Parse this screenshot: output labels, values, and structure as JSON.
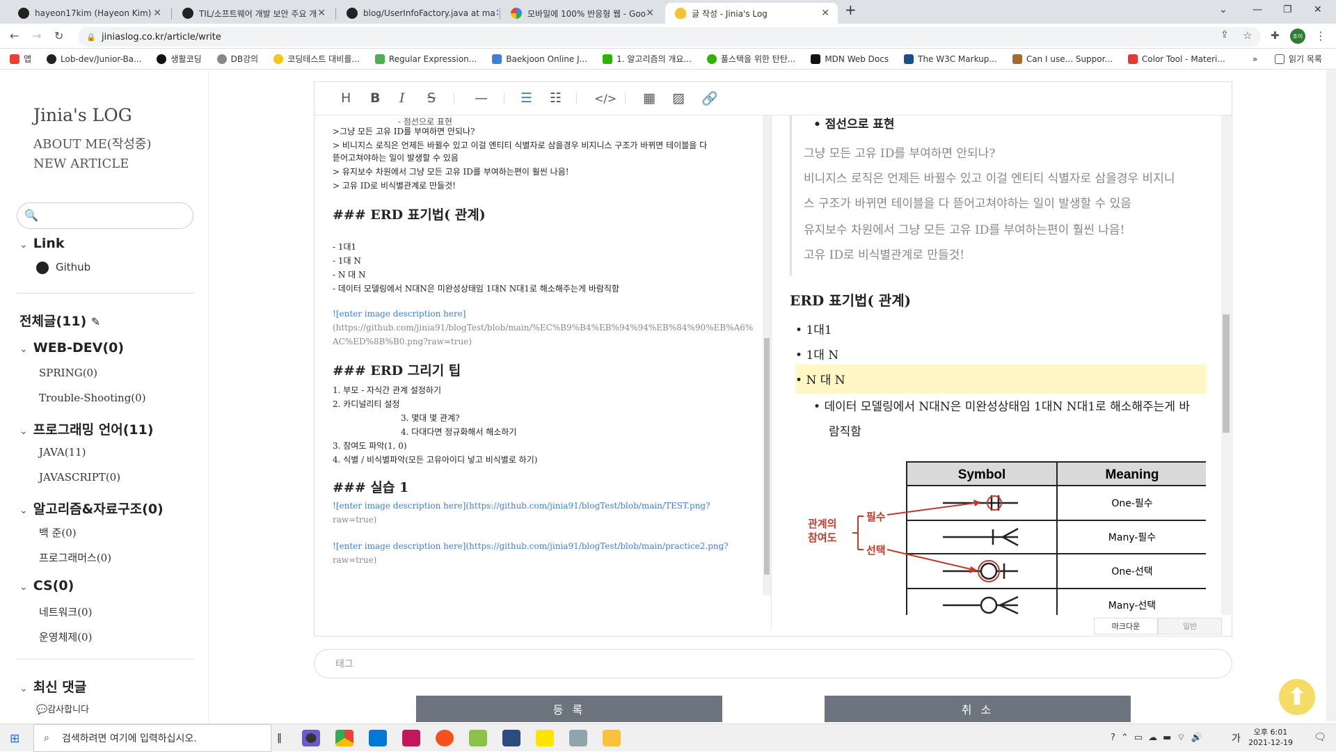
{
  "browser": {
    "tabs": [
      {
        "title": "hayeon17kim (Hayeon Kim)",
        "icon": "github-icon"
      },
      {
        "title": "TIL/소프트웨어 개발 보안 주요 개",
        "icon": "github-icon"
      },
      {
        "title": "blog/UserInfoFactory.java at ma",
        "icon": "github-icon"
      },
      {
        "title": "모바일에 100% 반응형 웹 - Goo",
        "icon": "google-icon"
      },
      {
        "title": "글 작성 - Jinia's Log",
        "icon": "bulb-icon"
      }
    ],
    "new_tab": "+",
    "url": "jiniaslog.co.kr/article/write",
    "profile": "조이",
    "bookmarks": [
      {
        "label": "앱",
        "color": "#e94235"
      },
      {
        "label": "Lob-dev/Junior-Ba...",
        "color": "#222222"
      },
      {
        "label": "생활코딩",
        "color": "#111111"
      },
      {
        "label": "DB강의",
        "color": "#555555"
      },
      {
        "label": "코딩테스트 대비를...",
        "color": "#f5c518"
      },
      {
        "label": "Regular Expression...",
        "color": "#4caf50"
      },
      {
        "label": "Baekjoon Online J...",
        "color": "#3f7fd8"
      },
      {
        "label": "1. 알고리즘의 개요...",
        "color": "#2db400"
      },
      {
        "label": "풀스택을 위한 탄탄...",
        "color": "#2db400"
      },
      {
        "label": "MDN Web Docs",
        "color": "#111111"
      },
      {
        "label": "The W3C Markup...",
        "color": "#1a4f8b"
      },
      {
        "label": "Can I use... Suppor...",
        "color": "#a36b2e"
      },
      {
        "label": "Color Tool - Materi...",
        "color": "#e53935"
      }
    ],
    "more": "»",
    "reading_list": "읽기 목록"
  },
  "sidebar": {
    "logo": "Jinia's LOG",
    "nav": [
      "ABOUT ME(작성중)",
      "NEW ARTICLE"
    ],
    "link_section": "Link",
    "link_items": [
      "Github"
    ],
    "all_posts": "전체글(11)",
    "categories": [
      {
        "name": "WEB-DEV(0)",
        "children": [
          "SPRING(0)",
          "Trouble-Shooting(0)"
        ]
      },
      {
        "name": "프로그래밍 언어(11)",
        "children": [
          "JAVA(11)",
          "JAVASCRIPT(0)"
        ]
      },
      {
        "name": "알고리즘&자료구조(0)",
        "children": [
          "백 준(0)",
          "프로그래머스(0)"
        ]
      },
      {
        "name": "CS(0)",
        "children": [
          "네트워크(0)",
          "운영체제(0)"
        ]
      }
    ],
    "recent_comments": "최신 댓글",
    "comment_items": [
      "감사합니다"
    ]
  },
  "markdown": [
    "- 점선으로 표현",
    ">그냥 모든 고유 ID를 부여하면 안되나?",
    "> 비니지스 로직은 언제든 바뀔수 있고 이걸 엔티티 식별자로 삼을경우 비지니스 구조가 바뀌면 테이블을 다",
    "뜯어고쳐야하는 일이 발생할 수 있음",
    "> 유지보수 차원에서 그냥 모든 고유 ID를 부여하는편이 훨씬 나음!",
    "> 고유 ID로 비식별관계로 만들것!",
    "### ERD 표기법( 관계)",
    "- 1대1",
    "- 1대 N",
    "- N 대 N",
    "  - 데이터 모델링에서 N대N은 미완성상태임 1대N N대1로 해소해주는게 바람직함",
    "![enter image description here]",
    "(https://github.com/jinia91/blogTest/blob/main/%EC%B9%B4%EB%94%94%EB%84%90%EB%A6%",
    "AC%ED%8B%B0.png?raw=true)",
    "### ERD 그리기 팁",
    "1. 부모 - 자식간 관계 설정하기",
    "2. 카디널리티 설정",
    "3. 몇대 몇 관계?",
    "4. 다대다면 정규화해서 해소하기",
    "3. 참여도 파악(1, 0)",
    "4. 식별 / 비식별파악(모든 고유아이디 넣고 비식별로 하기)",
    "### 실습 1",
    "![enter image description here](https://github.com/jinia91/blogTest/blob/main/TEST.png?",
    "raw=true)",
    "![enter image description here](https://github.com/jinia91/blogTest/blob/main/practice2.png?",
    "raw=true)"
  ],
  "preview": {
    "bullet_top": "점선으로 표현",
    "quote": [
      "그냥 모든 고유 ID를 부여하면 안되나?",
      "비니지스 로직은 언제든 바뀔수 있고 이걸 엔티티 식별자로 삼을경우 비지니",
      "스 구조가 바뀌면 테이블을 다 뜯어고쳐야하는 일이 발생할 수 있음",
      "유지보수 차원에서 그냥 모든 고유 ID를 부여하는편이 훨씬 나음!",
      "고유 ID로 비식별관계로 만들것!"
    ],
    "heading": "ERD 표기법( 관계)",
    "bullets": [
      "1대1",
      "1대 N",
      "N 대 N"
    ],
    "sub_bullet": [
      "데이터 모델링에서 N대N은 미완성상태임 1대N N대1로 해소해주는게 바",
      "람직함"
    ],
    "table_header": [
      "Symbol",
      "Meaning"
    ],
    "table_rows": [
      "One-필수",
      "Many-필수",
      "One-선택",
      "Many-선택"
    ],
    "diagram_labels": {
      "participation": [
        "관계의",
        "참여도"
      ],
      "mandatory": "필수",
      "optional": "선택"
    }
  },
  "modes": [
    "마크다운",
    "일반"
  ],
  "tag_placeholder": "태그",
  "buttons": {
    "submit": "등 록",
    "cancel": "취 소"
  },
  "taskbar": {
    "search": "검색하려면 여기에 입력하십시오.",
    "time": "오후 6:01",
    "date": "2021-12-19",
    "ime": "가"
  }
}
